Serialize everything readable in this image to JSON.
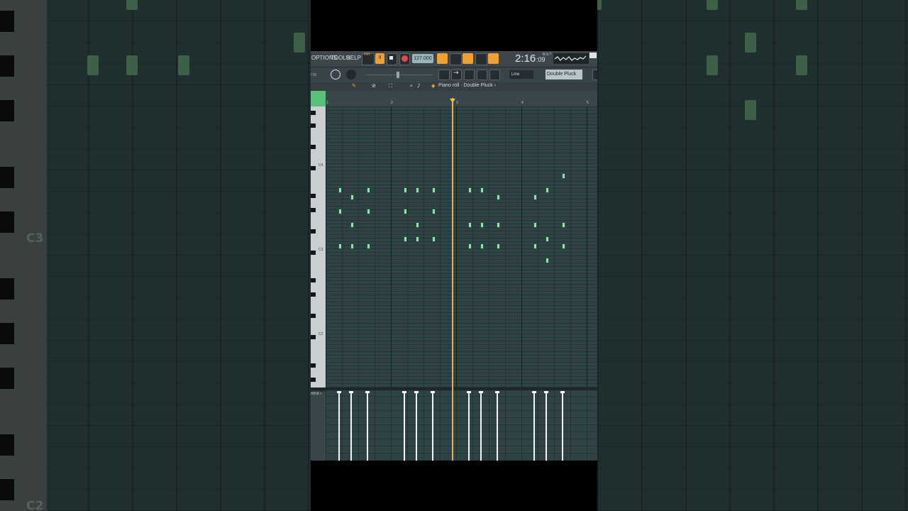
{
  "background": {
    "left_key_labels": [
      "C3",
      "C2"
    ],
    "note_color": "#3e5f48"
  },
  "daw": {
    "menu": [
      "OPTIONS",
      "TOOLS",
      "HELP"
    ],
    "pattern_badge": "PAT",
    "tempo": "127.000",
    "time": "2:16",
    "time_frac": ":09",
    "time_unit": "B:S:T",
    "snap": "Line",
    "instrument": "Double Pluck",
    "piano_roll_title": "Piano roll · Double Pluck ›",
    "bar_numbers": [
      "1",
      "2",
      "3",
      "4",
      "5"
    ],
    "key_labels": [
      "C4",
      "C3",
      "C2"
    ],
    "control_label": "ntrol ›",
    "accent": "#f0a030",
    "note_color": "#8fe5b0",
    "playhead_color": "#e0b33c"
  }
}
